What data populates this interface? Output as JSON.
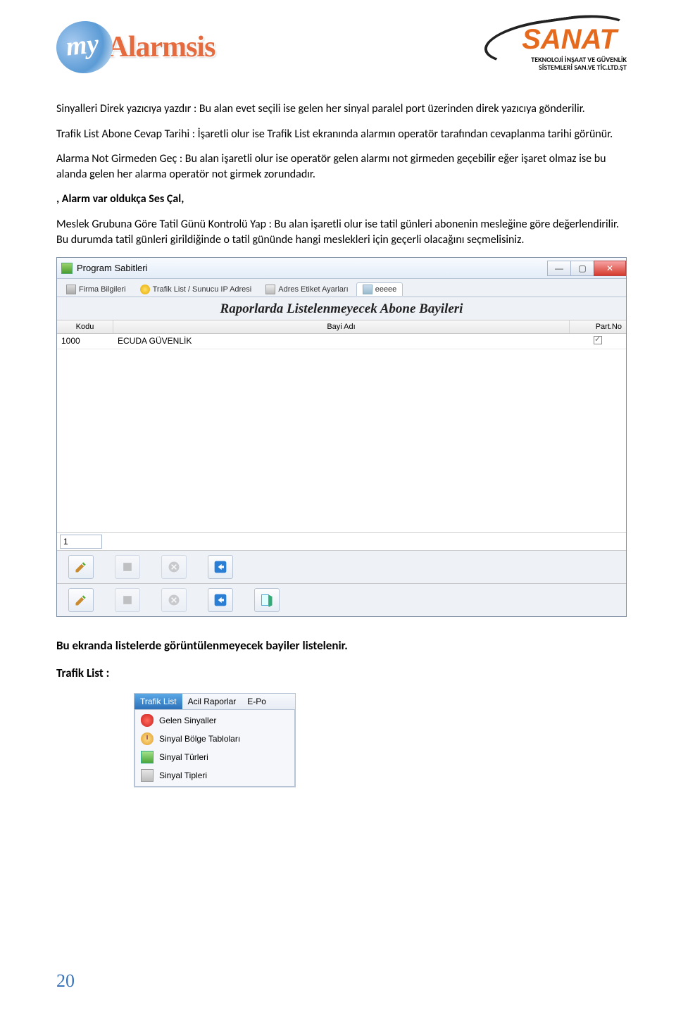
{
  "logos": {
    "left_my": "my",
    "left_brand": "Alarmsis",
    "right_brand": "SANAT",
    "right_sub1": "TEKNOLOJİ İNŞAAT VE GÜVENLİK",
    "right_sub2": "SİSTEMLERİ  SAN.VE  TİC.LTD.ŞT"
  },
  "para1": "Sinyalleri Direk yazıcıya yazdır : Bu alan evet seçili ise gelen her sinyal paralel port üzerinden direk yazıcıya gönderilir.",
  "para2": "Trafik List Abone Cevap Tarihi : İşaretli olur ise Trafik List ekranında alarmın operatör tarafından cevaplanma tarihi görünür.",
  "para3": " Alarma Not Girmeden Geç : Bu alan işaretli olur ise operatör gelen alarmı not girmeden geçebilir eğer işaret olmaz ise bu alanda gelen her alarma operatör not girmek zorundadır.",
  "para4": ", Alarm var oldukça Ses Çal,",
  "para5": " Meslek Grubuna Göre Tatil Günü Kontrolü Yap : Bu alan işaretli olur ise tatil günleri abonenin mesleğine göre değerlendirilir. Bu durumda tatil günleri girildiğinde o tatil gününde hangi meslekleri için geçerli olacağını seçmelisiniz.",
  "win1": {
    "title": "Program Sabitleri",
    "tabs": {
      "t1": "Firma Bilgileri",
      "t2": "Trafik List /  Sunucu IP Adresi",
      "t3": "Adres Etiket Ayarları",
      "t4": "eeeee"
    },
    "heading": "Raporlarda Listelenmeyecek Abone Bayileri",
    "cols": {
      "kodu": "Kodu",
      "bayi": "Bayi Adı",
      "part": "Part.No"
    },
    "row": {
      "kodu": "1000",
      "bayi": "ECUDA GÜVENLİK"
    },
    "input": "1",
    "winbtns": {
      "min": "—",
      "max": "▢",
      "close": "✕"
    }
  },
  "caption1": "Bu ekranda listelerde görüntülenmeyecek bayiler listelenir.",
  "caption2": "Trafik List :",
  "win2": {
    "menu": {
      "m1": "Trafik List",
      "m2": "Acil Raporlar",
      "m3": "E-Po"
    },
    "items": {
      "i1": "Gelen Sinyaller",
      "i2": "Sinyal Bölge Tabloları",
      "i3": "Sinyal Türleri",
      "i4": "Sinyal Tipleri"
    }
  },
  "pagenum": "20"
}
